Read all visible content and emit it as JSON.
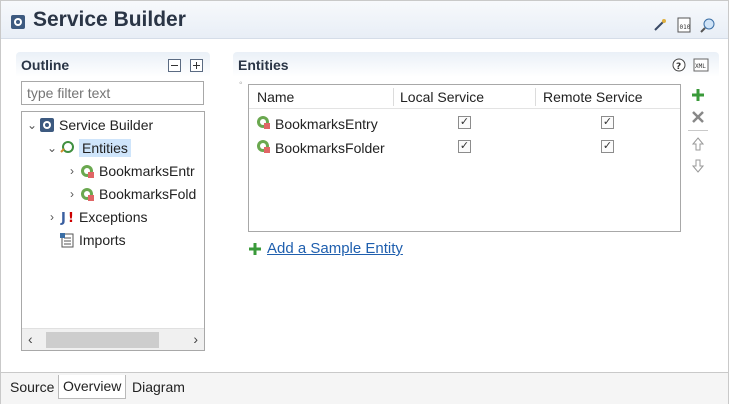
{
  "header": {
    "title": "Service Builder",
    "tools": [
      "wand-icon",
      "binary-icon",
      "search-icon"
    ]
  },
  "outline": {
    "title": "Outline",
    "filter_placeholder": "type filter text",
    "tree": [
      {
        "label": "Service Builder",
        "icon": "service-builder-icon",
        "expanded": true
      },
      {
        "label": "Entities",
        "icon": "entities-icon",
        "expanded": true,
        "selected": true
      },
      {
        "label": "BookmarksEntr",
        "icon": "entity-icon"
      },
      {
        "label": "BookmarksFold",
        "icon": "entity-icon"
      },
      {
        "label": "Exceptions",
        "icon": "exceptions-icon"
      },
      {
        "label": "Imports",
        "icon": "imports-icon"
      }
    ]
  },
  "entities": {
    "title": "Entities",
    "columns": [
      "Name",
      "Local Service",
      "Remote Service"
    ],
    "rows": [
      {
        "name": "BookmarksEntry",
        "local": true,
        "remote": true
      },
      {
        "name": "BookmarksFolder",
        "local": true,
        "remote": true
      }
    ],
    "add_link": "Add a Sample Entity"
  },
  "tabs": [
    "Source",
    "Overview",
    "Diagram"
  ],
  "active_tab": "Overview"
}
